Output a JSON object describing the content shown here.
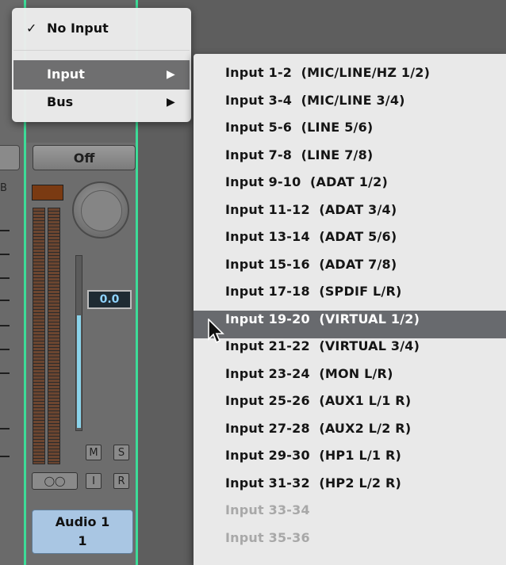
{
  "channel": {
    "off_label": "Off",
    "volume_value": "0.0",
    "track_name_line1": "Audio 1",
    "track_name_line2": "1",
    "mute_label": "M",
    "solo_label": "S",
    "input_monitor_label": "I",
    "record_label": "R",
    "link_label": "◯◯",
    "scale_label": "B"
  },
  "menu_top": {
    "no_input_label": "No Input",
    "no_input_checked": true,
    "checkmark": "✓",
    "input_label": "Input",
    "bus_label": "Bus",
    "submenu_arrow": "▶"
  },
  "input_submenu": {
    "items": [
      "Input 1-2  (MIC/LINE/HZ 1/2)",
      "Input 3-4  (MIC/LINE 3/4)",
      "Input 5-6  (LINE 5/6)",
      "Input 7-8  (LINE 7/8)",
      "Input 9-10  (ADAT 1/2)",
      "Input 11-12  (ADAT 3/4)",
      "Input 13-14  (ADAT 5/6)",
      "Input 15-16  (ADAT 7/8)",
      "Input 17-18  (SPDIF L/R)",
      "Input 19-20  (VIRTUAL 1/2)",
      "Input 21-22  (VIRTUAL 3/4)",
      "Input 23-24  (MON L/R)",
      "Input 25-26  (AUX1 L/1 R)",
      "Input 27-28  (AUX2 L/2 R)",
      "Input 29-30  (HP1 L/1 R)",
      "Input 31-32  (HP2 L/2 R)",
      "Input 33-34",
      "Input 35-36"
    ],
    "selected_index": 9,
    "disabled_from_index": 16
  },
  "colors": {
    "channel_outline": "#3ddc98",
    "highlight": "#686a6e",
    "volume_text": "#8fd3ff",
    "track_name_bg": "#a9c6e3"
  }
}
